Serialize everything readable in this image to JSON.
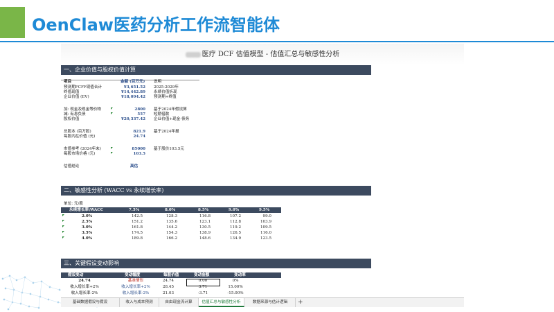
{
  "slide": {
    "title": "OenClaw医药分析工作流智能体"
  },
  "sheet": {
    "title": "医疗 DCF 估值模型 - 估值汇总与敏感性分析",
    "section1": {
      "header": "一、企业价值与股权价值计算",
      "col_item": "项目",
      "col_amount": "金额 (百万元)",
      "col_note": "说明",
      "rows": [
        {
          "label": "预测期FCFF现值合计",
          "value": "¥3,651.52",
          "note": "2025-2029年"
        },
        {
          "label": "终值现值",
          "value": "¥14,442.89",
          "note": "永续价值折现"
        },
        {
          "label": "企业价值 (EV)",
          "value": "¥18,094.42",
          "note": "预测期+终值"
        },
        {
          "label": "加: 现金及现金等价物",
          "value": "2800",
          "note": "基于2024年假设算"
        },
        {
          "label": "减: 有息负债",
          "value": "557",
          "note": "短期借款"
        },
        {
          "label": "股权价值",
          "value": "¥20,337.42",
          "note": "企业价值+现金-债务"
        },
        {
          "label": "总股本 (百万股)",
          "value": "821.9",
          "note": "基于2024年报"
        },
        {
          "label": "每股内在价值 (元)",
          "value": "24.74",
          "note": ""
        },
        {
          "label": "市值参考 (2024年末)",
          "value": "85000",
          "note": "基于股价103.5元"
        },
        {
          "label": "每股市场价格 (元)",
          "value": "103.5",
          "note": ""
        },
        {
          "label": "估值结论",
          "value": "高估",
          "note": ""
        }
      ]
    },
    "section2": {
      "header": "二、敏感性分析 (WACC vs 永续增长率)",
      "unit": "单位: 元/股",
      "corner": "永续增长率\\WACC",
      "cols": [
        "7.5%",
        "8.0%",
        "8.5%",
        "9.0%",
        "9.5%"
      ],
      "rows": [
        {
          "label": "2.0%",
          "values": [
            "142.5",
            "128.3",
            "116.8",
            "107.2",
            "99.0"
          ]
        },
        {
          "label": "2.5%",
          "values": [
            "151.2",
            "135.6",
            "123.1",
            "112.8",
            "103.9"
          ]
        },
        {
          "label": "3.0%",
          "values": [
            "161.8",
            "144.2",
            "130.5",
            "119.2",
            "109.5"
          ]
        },
        {
          "label": "3.5%",
          "values": [
            "174.5",
            "154.3",
            "138.9",
            "126.5",
            "116.0"
          ]
        },
        {
          "label": "4.0%",
          "values": [
            "189.8",
            "166.2",
            "148.6",
            "134.9",
            "123.5"
          ]
        }
      ]
    },
    "section3": {
      "header": "三、关键假设变动影响",
      "cols": [
        "假设变动",
        "变动幅度",
        "每股价值",
        "变动金额",
        "变动率"
      ],
      "rows": [
        [
          "24.74",
          "基准情形",
          "24.74",
          "0.00",
          "0%"
        ],
        [
          "收入增长率+2%",
          "收入增长率+2%",
          "28.45",
          "3.71",
          "15.00%"
        ],
        [
          "收入增长率-2%",
          "收入增长率-2%",
          "21.03",
          "-3.71",
          "-15.00%"
        ]
      ]
    },
    "tabs": [
      "基础数据假设与假设",
      "收入与成本预测",
      "自由现金流计算",
      "估值汇总与敏感性分析",
      "数据来源与估计逻辑",
      "+"
    ],
    "active_tab_index": 3
  },
  "colors": {
    "title_blue": "#1e8ad6",
    "accent_green": "#7ab648",
    "header_navy": "#3c4a5f",
    "tab_active": "#1f7a3b"
  }
}
